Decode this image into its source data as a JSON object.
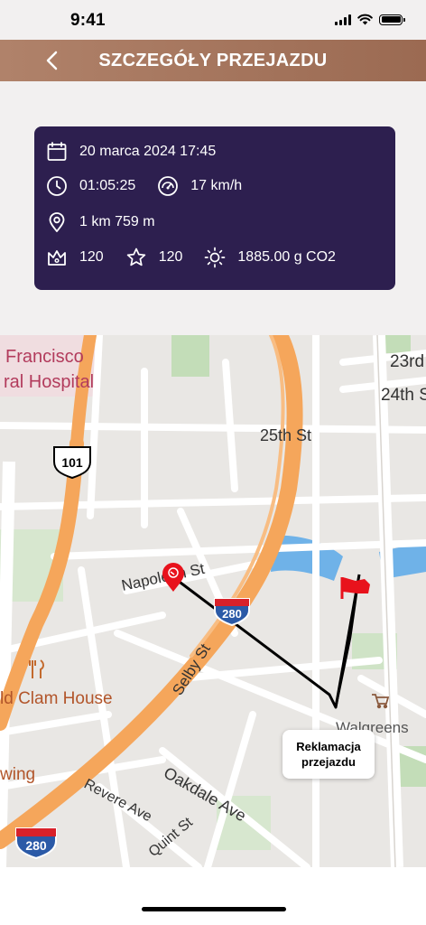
{
  "status": {
    "time": "9:41"
  },
  "header": {
    "title": "SZCZEGÓŁY PRZEJAZDU",
    "back_icon": "chevron-left-icon"
  },
  "ride": {
    "date": "20 marca 2024 17:45",
    "duration": "01:05:25",
    "speed": "17 km/h",
    "distance": "1 km 759 m",
    "points_crown": "120",
    "points_star": "120",
    "co2": "1885.00 g CO2"
  },
  "map": {
    "labels": {
      "hospital_1": "Francisco",
      "hospital_2": "ral Hospital",
      "st_23": "23rd",
      "st_24": "24th S",
      "st_25": "25th St",
      "hwy_101": "101",
      "napoleon": "Napoleon St",
      "i280_a": "280",
      "i280_b": "280",
      "selby": "Selby St",
      "clam": "ld Clam House",
      "walgreens": "Walgreens",
      "oakdale": "Oakdale Ave",
      "revere": "Revere Ave",
      "quint": "Quint St",
      "wing": "wing"
    }
  },
  "claim_button": {
    "line1": "Reklamacja",
    "line2": "przejazdu"
  },
  "colors": {
    "header": "#9b6a52",
    "card": "#2d1f4f",
    "route": "#000000",
    "marker": "#e8121c"
  }
}
